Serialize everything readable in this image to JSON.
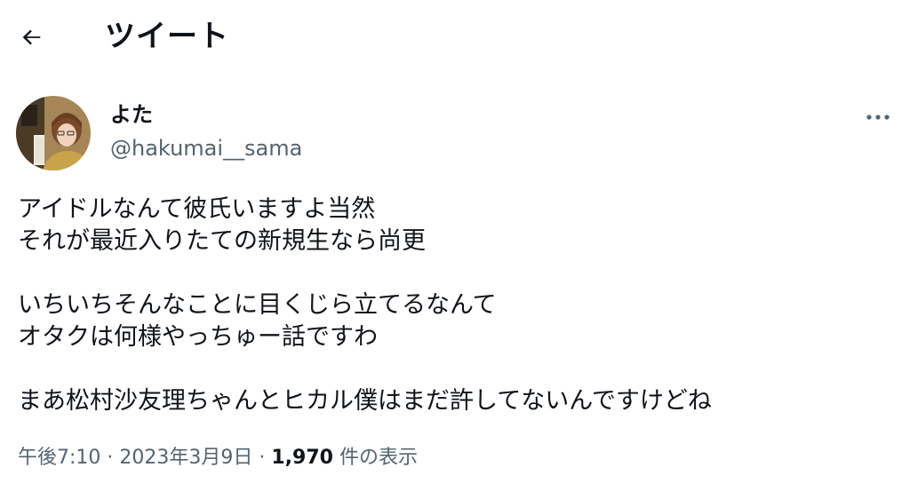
{
  "header": {
    "title": "ツイート",
    "back_icon": "arrow-left-icon"
  },
  "tweet": {
    "author": {
      "display_name": "よた",
      "handle": "@hakumai__sama",
      "avatar_icon": "user-avatar"
    },
    "more_icon": "more-horizontal-icon",
    "lines": [
      "アイドルなんて彼氏いますよ当然",
      "それが最近入りたての新規生なら尚更",
      "",
      "いちいちそんなことに目くじら立てるなんて",
      "オタクは何様やっちゅー話ですわ",
      "",
      "まあ松村沙友理ちゃんとヒカル僕はまだ許してないんですけどね"
    ],
    "meta": {
      "time": "午後7:10",
      "separator": " · ",
      "date": "2023年3月9日",
      "views_count": "1,970",
      "views_label": " 件の表示"
    }
  },
  "colors": {
    "text_primary": "#0f1419",
    "text_secondary": "#536471",
    "background": "#ffffff"
  }
}
